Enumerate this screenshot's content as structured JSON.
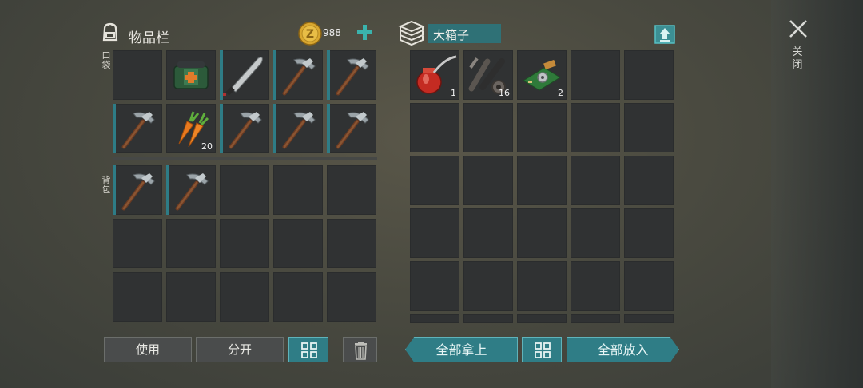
{
  "inventory": {
    "title": "物品栏",
    "coins": "988",
    "pocket_label": "口袋",
    "backpack_label": "背包",
    "pocket_items": [
      {
        "item": "empty-slot",
        "count": ""
      },
      {
        "item": "first-aid-bag",
        "count": ""
      },
      {
        "item": "machete",
        "count": ""
      },
      {
        "item": "pickaxe",
        "count": ""
      },
      {
        "item": "pickaxe",
        "count": ""
      },
      {
        "item": "pickaxe",
        "count": ""
      },
      {
        "item": "carrots",
        "count": "20"
      },
      {
        "item": "pickaxe",
        "count": ""
      },
      {
        "item": "pickaxe",
        "count": ""
      },
      {
        "item": "pickaxe",
        "count": ""
      }
    ],
    "backpack_items": [
      {
        "item": "pickaxe",
        "count": ""
      },
      {
        "item": "pickaxe",
        "count": ""
      }
    ]
  },
  "chest": {
    "title": "大箱子",
    "items": [
      {
        "item": "oil-can",
        "count": "1"
      },
      {
        "item": "engine-parts",
        "count": "16"
      },
      {
        "item": "circuit-board",
        "count": "2"
      }
    ]
  },
  "buttons": {
    "use": "使用",
    "split": "分开",
    "take_all": "全部拿上",
    "put_all": "全部放入"
  },
  "close_label": "关闭",
  "colors": {
    "accent": "#2f7d86",
    "slot": "#303233",
    "coin": "#e0b23a"
  }
}
